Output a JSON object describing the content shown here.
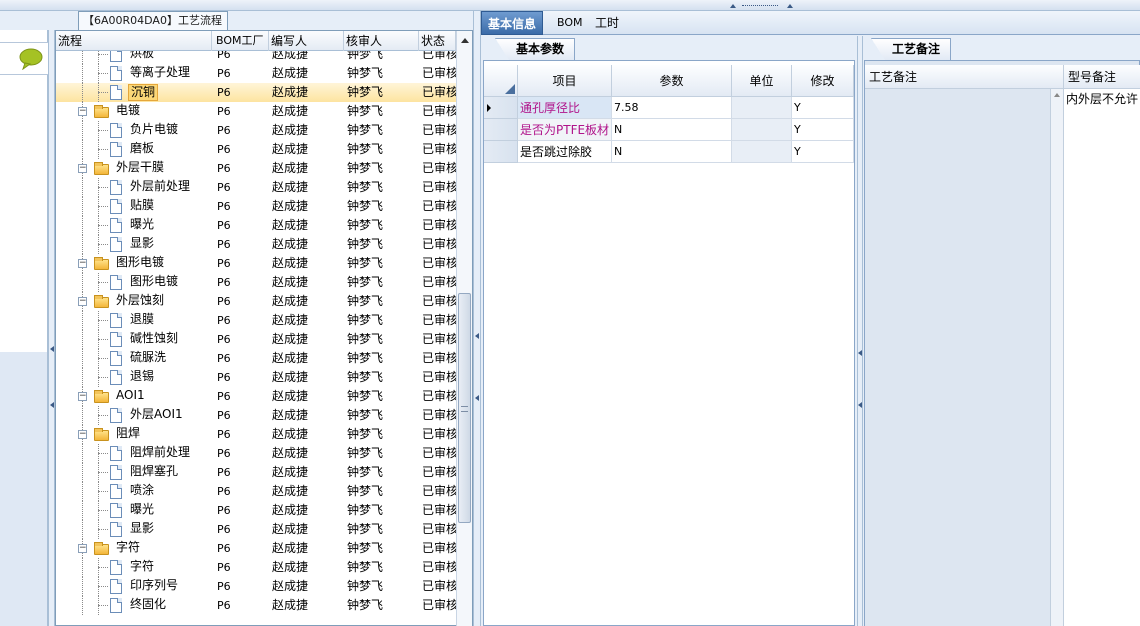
{
  "tree_panel": {
    "title": "【6A00R04DA0】工艺流程",
    "columns": [
      "流程",
      "BOM工厂",
      "编写人",
      "核审人",
      "状态"
    ],
    "rows": [
      {
        "name": "烘板",
        "level": 2,
        "type": "doc",
        "bom": "P6",
        "writer": "赵成捷",
        "reviewer": "钟梦飞",
        "status": "已审核"
      },
      {
        "name": "等离子处理",
        "level": 2,
        "type": "doc",
        "bom": "P6",
        "writer": "赵成捷",
        "reviewer": "钟梦飞",
        "status": "已审核"
      },
      {
        "name": "沉铜",
        "level": 2,
        "type": "doc",
        "bom": "P6",
        "writer": "赵成捷",
        "reviewer": "钟梦飞",
        "status": "已审核",
        "selected": true
      },
      {
        "name": "电镀",
        "level": 1,
        "type": "folder",
        "bom": "P6",
        "writer": "赵成捷",
        "reviewer": "钟梦飞",
        "status": "已审核"
      },
      {
        "name": "负片电镀",
        "level": 2,
        "type": "doc",
        "bom": "P6",
        "writer": "赵成捷",
        "reviewer": "钟梦飞",
        "status": "已审核"
      },
      {
        "name": "磨板",
        "level": 2,
        "type": "doc",
        "bom": "P6",
        "writer": "赵成捷",
        "reviewer": "钟梦飞",
        "status": "已审核"
      },
      {
        "name": "外层干膜",
        "level": 1,
        "type": "folder",
        "bom": "P6",
        "writer": "赵成捷",
        "reviewer": "钟梦飞",
        "status": "已审核"
      },
      {
        "name": "外层前处理",
        "level": 2,
        "type": "doc",
        "bom": "P6",
        "writer": "赵成捷",
        "reviewer": "钟梦飞",
        "status": "已审核"
      },
      {
        "name": "贴膜",
        "level": 2,
        "type": "doc",
        "bom": "P6",
        "writer": "赵成捷",
        "reviewer": "钟梦飞",
        "status": "已审核"
      },
      {
        "name": "曝光",
        "level": 2,
        "type": "doc",
        "bom": "P6",
        "writer": "赵成捷",
        "reviewer": "钟梦飞",
        "status": "已审核"
      },
      {
        "name": "显影",
        "level": 2,
        "type": "doc",
        "bom": "P6",
        "writer": "赵成捷",
        "reviewer": "钟梦飞",
        "status": "已审核"
      },
      {
        "name": "图形电镀",
        "level": 1,
        "type": "folder",
        "bom": "P6",
        "writer": "赵成捷",
        "reviewer": "钟梦飞",
        "status": "已审核"
      },
      {
        "name": "图形电镀",
        "level": 2,
        "type": "doc",
        "bom": "P6",
        "writer": "赵成捷",
        "reviewer": "钟梦飞",
        "status": "已审核"
      },
      {
        "name": "外层蚀刻",
        "level": 1,
        "type": "folder",
        "bom": "P6",
        "writer": "赵成捷",
        "reviewer": "钟梦飞",
        "status": "已审核"
      },
      {
        "name": "退膜",
        "level": 2,
        "type": "doc",
        "bom": "P6",
        "writer": "赵成捷",
        "reviewer": "钟梦飞",
        "status": "已审核"
      },
      {
        "name": "碱性蚀刻",
        "level": 2,
        "type": "doc",
        "bom": "P6",
        "writer": "赵成捷",
        "reviewer": "钟梦飞",
        "status": "已审核"
      },
      {
        "name": "硫脲洗",
        "level": 2,
        "type": "doc",
        "bom": "P6",
        "writer": "赵成捷",
        "reviewer": "钟梦飞",
        "status": "已审核"
      },
      {
        "name": "退锡",
        "level": 2,
        "type": "doc",
        "bom": "P6",
        "writer": "赵成捷",
        "reviewer": "钟梦飞",
        "status": "已审核"
      },
      {
        "name": "AOI1",
        "level": 1,
        "type": "folder",
        "bom": "P6",
        "writer": "赵成捷",
        "reviewer": "钟梦飞",
        "status": "已审核"
      },
      {
        "name": "外层AOI1",
        "level": 2,
        "type": "doc",
        "bom": "P6",
        "writer": "赵成捷",
        "reviewer": "钟梦飞",
        "status": "已审核"
      },
      {
        "name": "阻焊",
        "level": 1,
        "type": "folder",
        "bom": "P6",
        "writer": "赵成捷",
        "reviewer": "钟梦飞",
        "status": "已审核"
      },
      {
        "name": "阻焊前处理",
        "level": 2,
        "type": "doc",
        "bom": "P6",
        "writer": "赵成捷",
        "reviewer": "钟梦飞",
        "status": "已审核"
      },
      {
        "name": "阻焊塞孔",
        "level": 2,
        "type": "doc",
        "bom": "P6",
        "writer": "赵成捷",
        "reviewer": "钟梦飞",
        "status": "已审核"
      },
      {
        "name": "喷涂",
        "level": 2,
        "type": "doc",
        "bom": "P6",
        "writer": "赵成捷",
        "reviewer": "钟梦飞",
        "status": "已审核"
      },
      {
        "name": "曝光",
        "level": 2,
        "type": "doc",
        "bom": "P6",
        "writer": "赵成捷",
        "reviewer": "钟梦飞",
        "status": "已审核"
      },
      {
        "name": "显影",
        "level": 2,
        "type": "doc",
        "bom": "P6",
        "writer": "赵成捷",
        "reviewer": "钟梦飞",
        "status": "已审核"
      },
      {
        "name": "字符",
        "level": 1,
        "type": "folder",
        "bom": "P6",
        "writer": "赵成捷",
        "reviewer": "钟梦飞",
        "status": "已审核"
      },
      {
        "name": "字符",
        "level": 2,
        "type": "doc",
        "bom": "P6",
        "writer": "赵成捷",
        "reviewer": "钟梦飞",
        "status": "已审核"
      },
      {
        "name": "印序列号",
        "level": 2,
        "type": "doc",
        "bom": "P6",
        "writer": "赵成捷",
        "reviewer": "钟梦飞",
        "status": "已审核"
      },
      {
        "name": "终固化",
        "level": 2,
        "type": "doc",
        "bom": "P6",
        "writer": "赵成捷",
        "reviewer": "钟梦飞",
        "status": "已审核"
      }
    ]
  },
  "top_tabs": {
    "basic": "基本信息",
    "bom": "BOM",
    "hours": "工时"
  },
  "params": {
    "tab": "基本参数",
    "columns": {
      "item": "项目",
      "param": "参数",
      "unit": "单位",
      "modify": "修改"
    },
    "rows": [
      {
        "item": "通孔厚径比",
        "param": "7.58",
        "unit": "",
        "modify": "Y",
        "highlight": true,
        "current": true
      },
      {
        "item": "是否为PTFE板材",
        "param": "N",
        "unit": "",
        "modify": "Y",
        "highlight": true
      },
      {
        "item": "是否跳过除胶",
        "param": "N",
        "unit": "",
        "modify": "Y",
        "highlight": false
      }
    ]
  },
  "notes": {
    "tab": "工艺备注",
    "columns": {
      "process_note": "工艺备注",
      "model_note": "型号备注"
    },
    "model_note_value": "内外层不允许",
    "colors": {
      "highlight_text": "#b0138a",
      "selected_row": "#fde4a0"
    }
  }
}
